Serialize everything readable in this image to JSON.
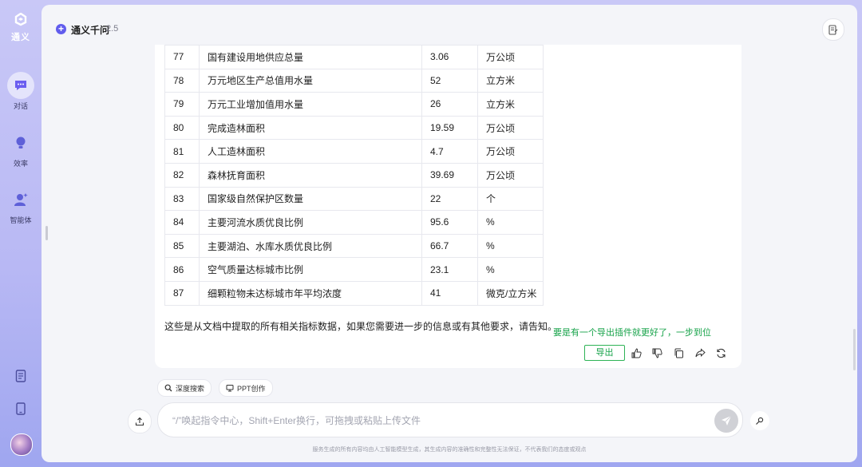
{
  "app": {
    "name": "通义",
    "model_name": "通义千问",
    "model_version": "2.5"
  },
  "sidebar": {
    "items": [
      {
        "label": "对话",
        "icon": "chat-icon"
      },
      {
        "label": "效率",
        "icon": "lightbulb-icon"
      },
      {
        "label": "智能体",
        "icon": "agent-icon"
      }
    ]
  },
  "table": {
    "rows": [
      [
        "77",
        "国有建设用地供应总量",
        "3.06",
        "万公顷"
      ],
      [
        "78",
        "万元地区生产总值用水量",
        "52",
        "立方米"
      ],
      [
        "79",
        "万元工业增加值用水量",
        "26",
        "立方米"
      ],
      [
        "80",
        "完成造林面积",
        "19.59",
        "万公顷"
      ],
      [
        "81",
        "人工造林面积",
        "4.7",
        "万公顷"
      ],
      [
        "82",
        "森林抚育面积",
        "39.69",
        "万公顷"
      ],
      [
        "83",
        "国家级自然保护区数量",
        "22",
        "个"
      ],
      [
        "84",
        "主要河流水质优良比例",
        "95.6",
        "%"
      ],
      [
        "85",
        "主要湖泊、水库水质优良比例",
        "66.7",
        "%"
      ],
      [
        "86",
        "空气质量达标城市比例",
        "23.1",
        "%"
      ],
      [
        "87",
        "细颗粒物未达标城市年平均浓度",
        "41",
        "微克/立方米"
      ]
    ]
  },
  "message": {
    "summary": "这些是从文档中提取的所有相关指标数据，如果您需要进一步的信息或有其他要求，请告知。",
    "annotation": "要是有一个导出插件就更好了，一步到位",
    "export_label": "导出"
  },
  "chips": [
    {
      "label": "深度搜索",
      "icon": "search-icon"
    },
    {
      "label": "PPT创作",
      "icon": "ppt-icon"
    }
  ],
  "input": {
    "placeholder": "“/”唤起指令中心，Shift+Enter换行，可拖拽或粘贴上传文件"
  },
  "footer": "服务生成的所有内容均由人工智能模型生成，其生成内容的准确性和完整性无法保证，不代表我们的态度或观点",
  "colors": {
    "accent": "#615ced",
    "annotation_green": "#17a34a",
    "background": "#f4f5f9"
  }
}
